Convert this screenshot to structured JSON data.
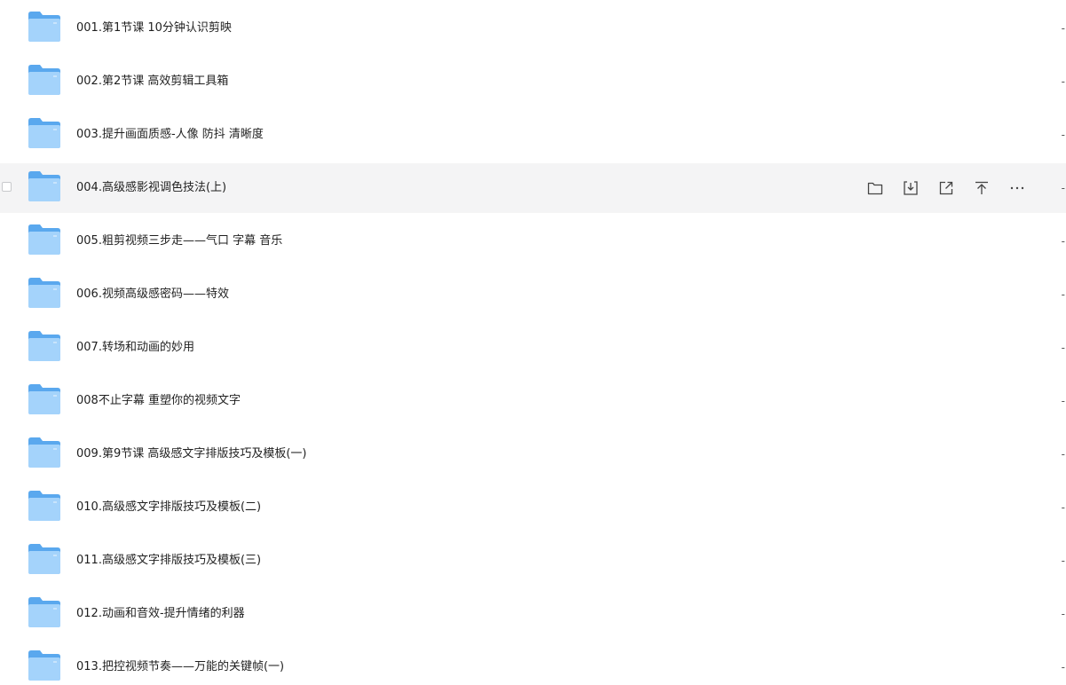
{
  "rows": [
    {
      "name": "001.第1节课 10分钟认识剪映",
      "trailing": "-"
    },
    {
      "name": "002.第2节课 高效剪辑工具箱",
      "trailing": "-"
    },
    {
      "name": "003.提升画面质感-人像 防抖 清晰度",
      "trailing": "-"
    },
    {
      "name": "004.高级感影视调色技法(上)",
      "trailing": "-"
    },
    {
      "name": "005.粗剪视频三步走——气口 字幕 音乐",
      "trailing": "-"
    },
    {
      "name": "006.视频高级感密码——特效",
      "trailing": "-"
    },
    {
      "name": "007.转场和动画的妙用",
      "trailing": "-"
    },
    {
      "name": "008不止字幕 重塑你的视频文字",
      "trailing": "-"
    },
    {
      "name": "009.第9节课 高级感文字排版技巧及模板(一)",
      "trailing": "-"
    },
    {
      "name": "010.高级感文字排版技巧及模板(二)",
      "trailing": "-"
    },
    {
      "name": "011.高级感文字排版技巧及模板(三)",
      "trailing": "-"
    },
    {
      "name": "012.动画和音效-提升情绪的利器",
      "trailing": "-"
    },
    {
      "name": "013.把控视频节奏——万能的关键帧(一)",
      "trailing": "-"
    }
  ],
  "hovered_row": 3,
  "hover_actions": [
    {
      "icon": "folder-move-icon"
    },
    {
      "icon": "download-icon"
    },
    {
      "icon": "share-icon"
    },
    {
      "icon": "pin-to-top-icon"
    },
    {
      "icon": "more-icon"
    }
  ],
  "colors": {
    "folder_back": "#5aa8ee",
    "folder_front": "#a4d3fb",
    "hover_bg": "#f4f4f5",
    "text": "#1f1f1f",
    "icon": "#444444"
  }
}
